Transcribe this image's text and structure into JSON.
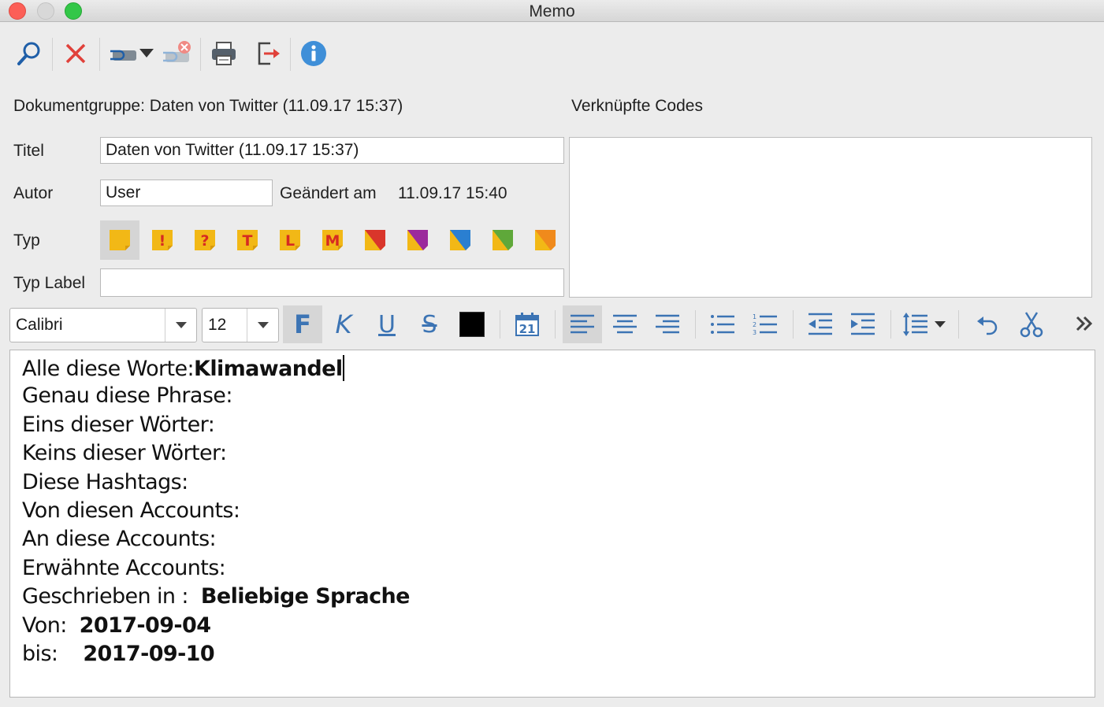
{
  "window": {
    "title": "Memo"
  },
  "toolbar": {
    "icons": [
      "search-icon",
      "delete-icon",
      "link-icon",
      "unlink-icon",
      "print-icon",
      "export-icon",
      "info-icon"
    ]
  },
  "header": {
    "doc_group": "Dokumentgruppe: Daten von Twitter (11.09.17 15:37)",
    "linked_codes_label": "Verknüpfte Codes"
  },
  "form": {
    "title_label": "Titel",
    "title_value": "Daten von Twitter (11.09.17 15:37)",
    "author_label": "Autor",
    "author_value": "User",
    "changed_label": "Geändert am",
    "changed_value": "11.09.17 15:40",
    "type_label": "Typ",
    "type_label_label": "Typ Label",
    "type_label_value": ""
  },
  "memo_types": [
    {
      "glyph": "",
      "color": "#f2b816"
    },
    {
      "glyph": "!",
      "color": "#f2b816"
    },
    {
      "glyph": "?",
      "color": "#f2b816"
    },
    {
      "glyph": "T",
      "color": "#f2b816"
    },
    {
      "glyph": "L",
      "color": "#f2b816"
    },
    {
      "glyph": "M",
      "color": "#f2b816"
    },
    {
      "glyph": "",
      "color": "#d9362b"
    },
    {
      "glyph": "",
      "color": "#9b2a9c"
    },
    {
      "glyph": "",
      "color": "#2a7fd1"
    },
    {
      "glyph": "",
      "color": "#5fa83a"
    },
    {
      "glyph": "",
      "color": "#f08a1c"
    }
  ],
  "format": {
    "font": "Calibri",
    "size": "12",
    "bold": "F",
    "italic": "K",
    "underline": "U",
    "strike": "S",
    "text_color": "#000000",
    "calendar_day": "21"
  },
  "editor": {
    "lines": [
      {
        "label": "Alle diese Worte:",
        "value": "Klimawandel"
      },
      {
        "label": "Genau diese Phrase:",
        "value": ""
      },
      {
        "label": "Eins dieser Wörter:",
        "value": ""
      },
      {
        "label": "Keins dieser Wörter:",
        "value": ""
      },
      {
        "label": "Diese Hashtags:",
        "value": ""
      },
      {
        "label": "Von diesen Accounts:",
        "value": ""
      },
      {
        "label": "An diese Accounts:",
        "value": ""
      },
      {
        "label": "Erwähnte Accounts:",
        "value": ""
      },
      {
        "label": "Geschrieben in :  ",
        "value": "Beliebige Sprache"
      },
      {
        "label": "Von:  ",
        "value": "2017-09-04"
      },
      {
        "label": "bis:    ",
        "value": "2017-09-10"
      }
    ]
  }
}
